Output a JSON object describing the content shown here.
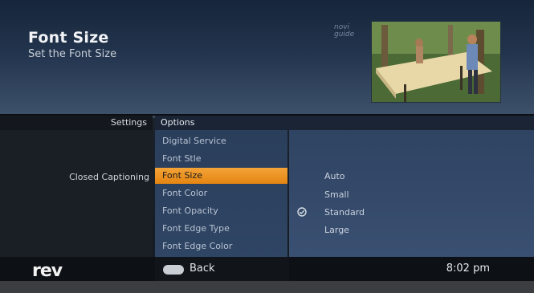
{
  "header": {
    "title": "Font Size",
    "subtitle": "Set the Font Size",
    "brand_small_line1": "novi",
    "brand_small_line2": "guide"
  },
  "columns": {
    "settings_label": "Settings",
    "options_label": "Options"
  },
  "settings": {
    "active_category": "Closed Captioning"
  },
  "options": [
    {
      "label": "Digital Service",
      "selected": false
    },
    {
      "label": "Font Stle",
      "selected": false
    },
    {
      "label": "Font Size",
      "selected": true
    },
    {
      "label": "Font Color",
      "selected": false
    },
    {
      "label": "Font Opacity",
      "selected": false
    },
    {
      "label": "Font Edge Type",
      "selected": false
    },
    {
      "label": "Font Edge Color",
      "selected": false
    }
  ],
  "values": [
    {
      "label": "Auto",
      "checked": false
    },
    {
      "label": "Small",
      "checked": false
    },
    {
      "label": "Standard",
      "checked": true
    },
    {
      "label": "Large",
      "checked": false
    }
  ],
  "footer": {
    "logo_text": "rev",
    "back_label": "Back",
    "time": "8:02 pm"
  },
  "colors": {
    "highlight": "#f0951f",
    "panel": "#2f4564"
  }
}
